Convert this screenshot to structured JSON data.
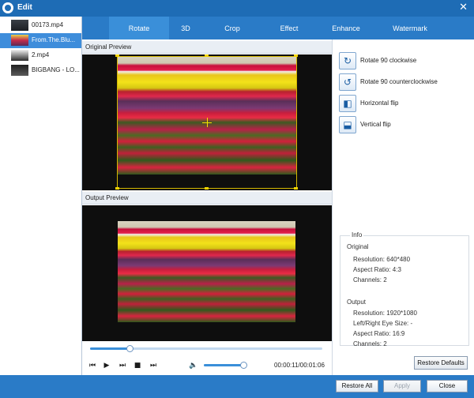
{
  "window": {
    "title": "Edit",
    "close_glyph": "✕"
  },
  "files": [
    {
      "name": "00173.mp4",
      "selected": false
    },
    {
      "name": "From.The.Blu...",
      "selected": true
    },
    {
      "name": "2.mp4",
      "selected": false
    },
    {
      "name": "BIGBANG - LO...",
      "selected": false
    }
  ],
  "tabs": [
    "Rotate",
    "3D",
    "Crop",
    "Effect",
    "Enhance",
    "Watermark"
  ],
  "active_tab": "Rotate",
  "preview": {
    "original_label": "Original Preview",
    "output_label": "Output Preview"
  },
  "actions": [
    {
      "label": "Rotate 90 clockwise",
      "icon": "rotate-clockwise-icon",
      "glyph": "↻"
    },
    {
      "label": "Rotate 90 counterclockwise",
      "icon": "rotate-counterclockwise-icon",
      "glyph": "↺"
    },
    {
      "label": "Horizontal flip",
      "icon": "horizontal-flip-icon",
      "glyph": "◧"
    },
    {
      "label": "Vertical flip",
      "icon": "vertical-flip-icon",
      "glyph": "⬓"
    }
  ],
  "info": {
    "title": "Info",
    "original_heading": "Original",
    "original_resolution": "Resolution: 640*480",
    "original_aspect": "Aspect Ratio: 4:3",
    "original_channels": "Channels: 2",
    "output_heading": "Output",
    "output_resolution": "Resolution: 1920*1080",
    "output_eye_size": "Left/Right Eye Size: -",
    "output_aspect": "Aspect Ratio: 16:9",
    "output_channels": "Channels: 2"
  },
  "player": {
    "progress_fraction": 0.17,
    "volume_fraction": 0.96,
    "time": "00:00:11/00:01:06",
    "icons": [
      "prev-frame-icon",
      "play-icon",
      "next-icon",
      "stop-icon",
      "end-icon",
      "volume-icon"
    ]
  },
  "buttons": {
    "restore_defaults": "Restore Defaults",
    "restore_all": "Restore All",
    "apply": "Apply",
    "close": "Close"
  },
  "colors": {
    "titlebar": "#1e6cb5",
    "tabbar": "#2a7bc7",
    "active_tab": "#3a8fd9",
    "crop_frame": "#f2d400"
  }
}
